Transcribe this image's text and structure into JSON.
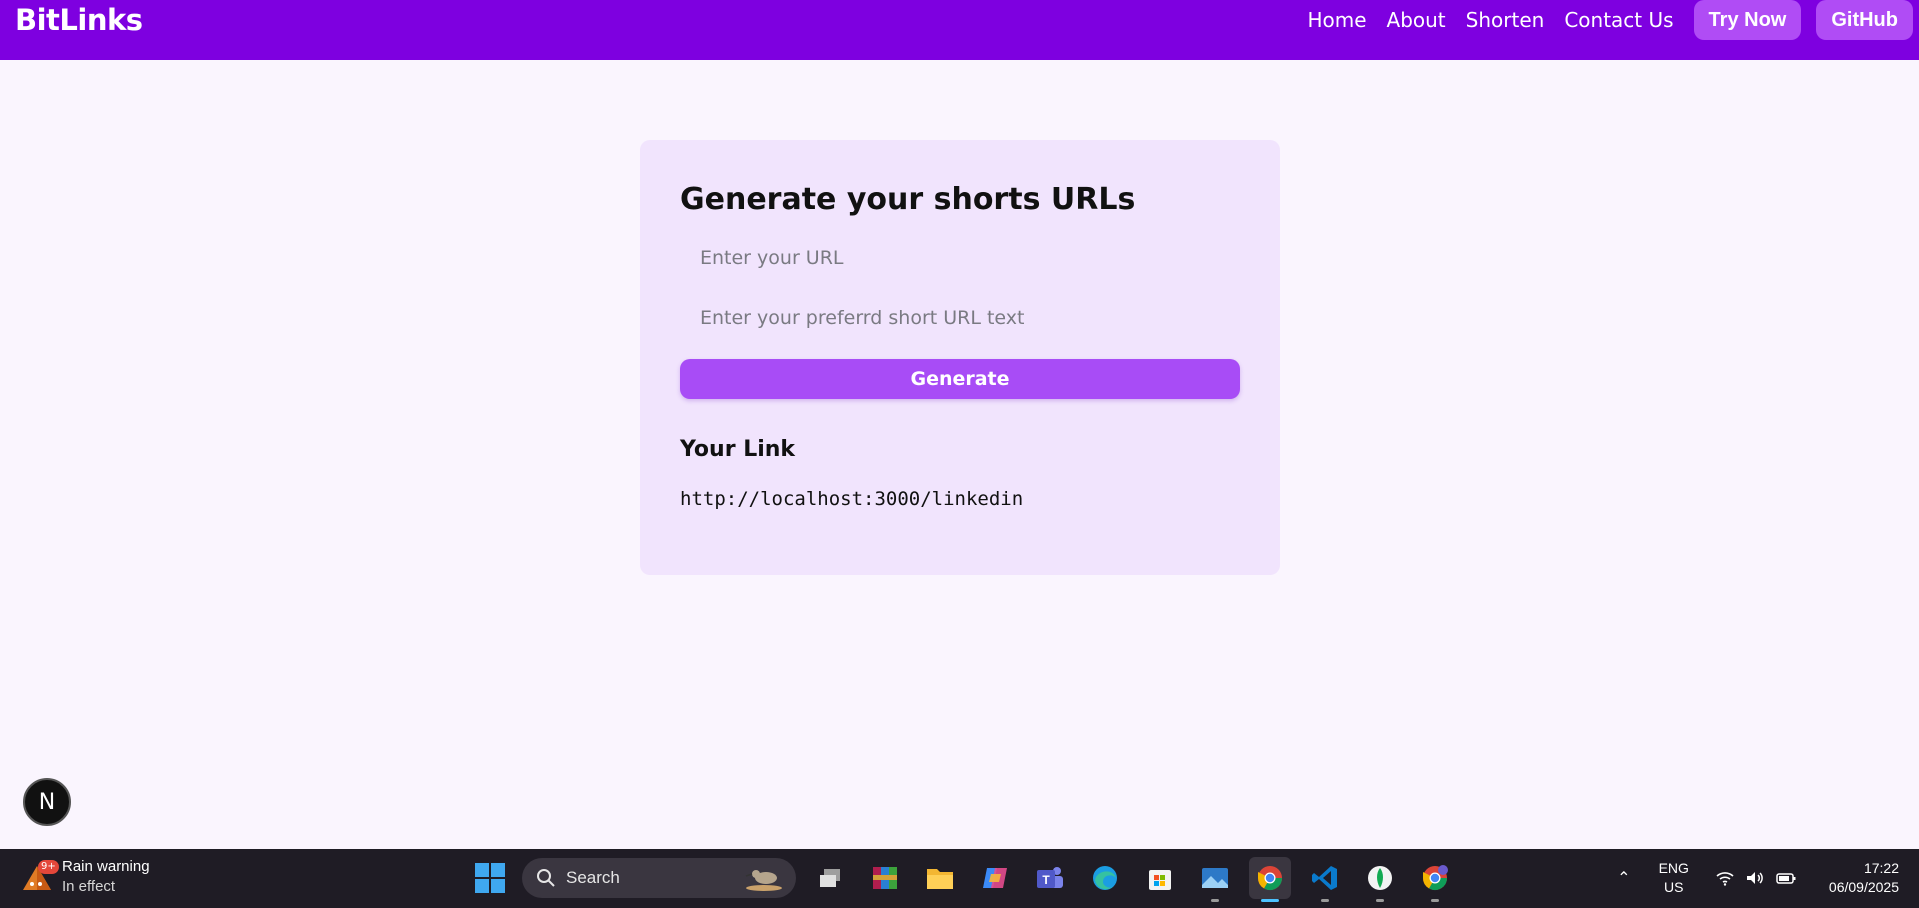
{
  "navbar": {
    "brand": "BitLinks",
    "links": [
      "Home",
      "About",
      "Shorten",
      "Contact Us"
    ],
    "buttons": [
      "Try Now",
      "GitHub"
    ],
    "background_color": "#7e00e0",
    "button_color": "#b04cf5"
  },
  "card": {
    "title": "Generate your shorts URLs",
    "url_placeholder": "Enter your URL",
    "url_value": "",
    "short_placeholder": "Enter your preferrd short URL text",
    "short_value": "",
    "generate_label": "Generate",
    "link_heading": "Your Link",
    "link_value": "http://localhost:3000/linkedin",
    "background_color": "#f1e4fd",
    "button_color": "#a84cf6"
  },
  "dev_badge": {
    "letter": "N"
  },
  "taskbar": {
    "weather": {
      "badge": "9+",
      "title": "Rain warning",
      "subtitle": "In effect",
      "icon": "weather-alert-icon"
    },
    "search_label": "Search",
    "apps": [
      {
        "name": "task-view-icon"
      },
      {
        "name": "winrar-icon"
      },
      {
        "name": "file-explorer-icon"
      },
      {
        "name": "copilot-icon"
      },
      {
        "name": "teams-icon"
      },
      {
        "name": "edge-icon"
      },
      {
        "name": "microsoft-store-icon"
      },
      {
        "name": "photos-icon"
      },
      {
        "name": "chrome-icon",
        "active": true
      },
      {
        "name": "vscode-icon"
      },
      {
        "name": "mongodb-compass-icon"
      },
      {
        "name": "chrome-profile-icon"
      }
    ],
    "language": {
      "line1": "ENG",
      "line2": "US"
    },
    "time": "17:22",
    "date": "06/09/2025"
  }
}
